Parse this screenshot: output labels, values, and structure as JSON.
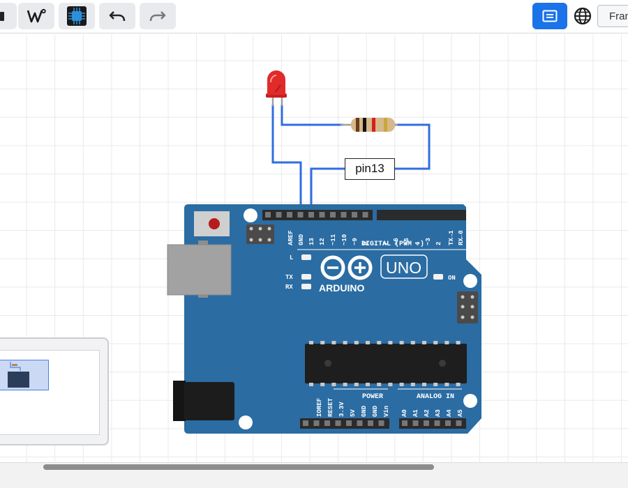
{
  "toolbar": {
    "buttons": [
      {
        "name": "save-icon"
      },
      {
        "name": "wokwi-icon"
      },
      {
        "name": "chip-icon"
      },
      {
        "name": "undo-icon"
      },
      {
        "name": "redo-icon"
      }
    ],
    "view_toggle_icon": "editor-view-icon",
    "language_icon": "globe-icon",
    "frame_button_label": "Fran"
  },
  "colors": {
    "accent": "#1a73e8",
    "board": "#2b6ca3",
    "wire": "#2f6ee0",
    "led": "#e12a2a"
  },
  "canvas": {
    "wire_label": "pin13"
  },
  "board": {
    "brand": "ARDUINO",
    "model": "UNO",
    "digital_header": "DIGITAL (PWM ~)",
    "digital_pins": [
      "AREF",
      "GND",
      "13",
      "12",
      "~11",
      "~10",
      "~9",
      "8",
      "7",
      "~6",
      "~5",
      "4",
      "~3",
      "2",
      "TX→1",
      "RX←0"
    ],
    "led_labels": {
      "l": "L",
      "tx": "TX",
      "rx": "RX",
      "on": "ON"
    },
    "power_header": "POWER",
    "power_pins": [
      "IOREF",
      "RESET",
      "3.3V",
      "5V",
      "GND",
      "GND",
      "Vin"
    ],
    "analog_header": "ANALOG IN",
    "analog_pins": [
      "A0",
      "A1",
      "A2",
      "A3",
      "A4",
      "A5"
    ]
  }
}
